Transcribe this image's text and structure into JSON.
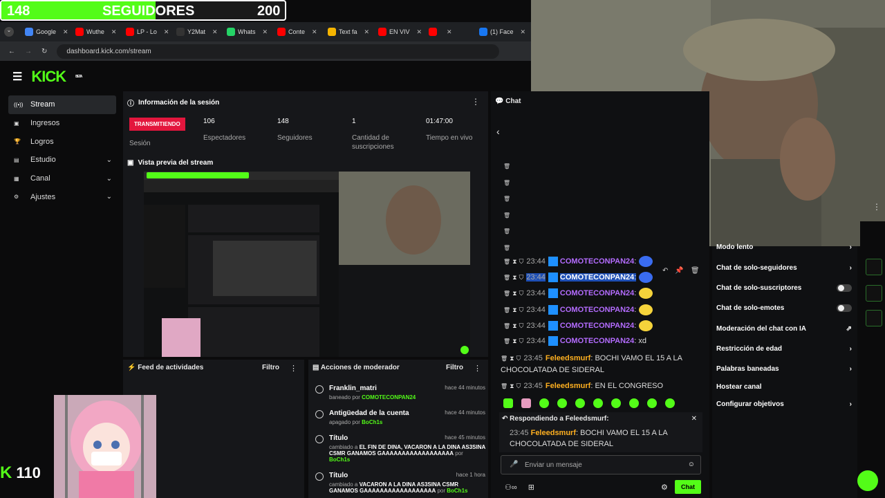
{
  "follower_bar": {
    "current": "148",
    "label": "SEGUIDORES",
    "goal": "200",
    "progress": 0.74
  },
  "browser": {
    "tabs": [
      {
        "label": "Google",
        "color": "#4285f4"
      },
      {
        "label": "Wuthe",
        "color": "#ff0000"
      },
      {
        "label": "LP - Lo",
        "color": "#ff0000"
      },
      {
        "label": "Y2Mat",
        "color": "#333333"
      },
      {
        "label": "Whats",
        "color": "#25d366"
      },
      {
        "label": "Conte",
        "color": "#ff0000"
      },
      {
        "label": "Text fa",
        "color": "#f5b400"
      },
      {
        "label": "EN VIV",
        "color": "#ff0000"
      },
      {
        "label": "",
        "color": "#ff0000"
      },
      {
        "label": "(1) Face",
        "color": "#1877f2"
      }
    ],
    "url": "dashboard.kick.com/stream"
  },
  "app": {
    "logo": "KICK",
    "beta": "BETA"
  },
  "nav": [
    {
      "label": "Stream",
      "icon": "stream-icon",
      "active": true
    },
    {
      "label": "Ingresos",
      "icon": "wallet-icon"
    },
    {
      "label": "Logros",
      "icon": "trophy-icon"
    },
    {
      "label": "Estudio",
      "icon": "studio-icon",
      "chevron": true
    },
    {
      "label": "Canal",
      "icon": "channel-icon",
      "chevron": true
    },
    {
      "label": "Ajustes",
      "icon": "gear-icon",
      "chevron": true
    }
  ],
  "session": {
    "title": "Información de la sesión",
    "status": "TRANSMITIENDO",
    "status_label": "Sesión",
    "stats": [
      {
        "value": "106",
        "label": "Espectadores"
      },
      {
        "value": "148",
        "label": "Seguidores"
      },
      {
        "value": "1",
        "label": "Cantidad de suscripciones"
      },
      {
        "value": "01:47:00",
        "label": "Tiempo en vivo"
      }
    ]
  },
  "preview": {
    "title": "Vista previa del stream"
  },
  "feed": {
    "title": "Feed de actividades",
    "filter": "Filtro"
  },
  "mod": {
    "title": "Acciones de moderador",
    "filter": "Filtro",
    "items": [
      {
        "title": "Franklin_matri",
        "pre": "baneado por ",
        "who": "COMOTECONPAN24",
        "time": "hace 44 minutos"
      },
      {
        "title": "Antigüedad de la cuenta",
        "pre": "apagado por ",
        "who": "BoCh1s",
        "time": "hace 44 minutos"
      },
      {
        "title": "Título",
        "pre": "cambiado a ",
        "bold": "EL FIN DE DINA, VACARON A LA DINA AS3SINA CSMR GANAMOS GAAAAAAAAAAAAAAAAAA",
        "post": " por ",
        "who": "BoCh1s",
        "time": "hace 45 minutos"
      },
      {
        "title": "Título",
        "pre": "cambiado a ",
        "bold": "VACARON A LA DINA AS3SINA CSMR GANAMOS GAAAAAAAAAAAAAAAAAA",
        "post": " por ",
        "who": "BoCh1s",
        "time": "hace 1 hora"
      }
    ]
  },
  "chat": {
    "title": "Chat",
    "messages": [
      {
        "time": "23:44",
        "user": "COMOTECONPAN24",
        "text": ":",
        "emote": "blue"
      },
      {
        "time": "23:44",
        "user": "COMOTECONPAN24",
        "text": ":",
        "emote": "blue",
        "highlight": true
      },
      {
        "time": "23:44",
        "user": "COMOTECONPAN24",
        "text": ":",
        "emote": "yellow"
      },
      {
        "time": "23:44",
        "user": "COMOTECONPAN24",
        "text": ":",
        "emote": "yellow"
      },
      {
        "time": "23:44",
        "user": "COMOTECONPAN24",
        "text": ":",
        "emote": "yellow"
      },
      {
        "time": "23:44",
        "user": "COMOTECONPAN24",
        "text": ": xd"
      }
    ],
    "feleed1": {
      "time": "23:45",
      "user": "Feleedsmurf",
      "text": ": BOCHI VAMO EL 15 A LA",
      "text2": "CHOCOLATADA DE SIDERAL"
    },
    "feleed2": {
      "time": "23:45",
      "user": "Feleedsmurf",
      "text": ": EN EL CONGRESO"
    },
    "reply": {
      "label": "Respondiendo a Feleedsmurf:",
      "time": "23:45",
      "user": "Feleedsmurf",
      "text": ": BOCHI VAMO EL 15 A LA",
      "text2": "CHOCOLATADA DE SIDERAL"
    },
    "input_placeholder": "Enviar un mensaje",
    "send": "Chat"
  },
  "settings": [
    {
      "label": "Modo lento",
      "type": "arrow"
    },
    {
      "label": "Chat de solo-seguidores",
      "type": "arrow"
    },
    {
      "label": "Chat de solo-suscriptores",
      "type": "toggle"
    },
    {
      "label": "Chat de solo-emotes",
      "type": "toggle"
    },
    {
      "label": "Moderación del chat con IA",
      "type": "link"
    },
    {
      "label": "Restricción de edad",
      "type": "arrow"
    },
    {
      "label": "Palabras baneadas",
      "type": "arrow"
    },
    {
      "label": "Hostear canal",
      "type": "none"
    },
    {
      "label": "Configurar objetivos",
      "type": "arrow"
    }
  ],
  "overlay": {
    "viewer_count": "110"
  }
}
